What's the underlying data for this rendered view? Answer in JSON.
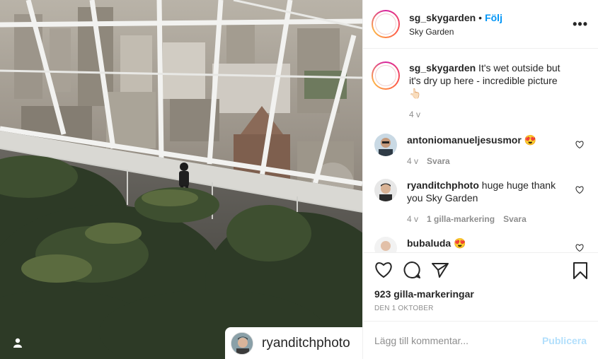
{
  "post": {
    "author": "sg_skygarden",
    "follow_label": "Följ",
    "location": "Sky Garden",
    "more_label": "•••"
  },
  "photo_tag": {
    "username": "ryanditchphoto"
  },
  "comments": [
    {
      "user": "sg_skygarden",
      "text": " It's wet outside but it's dry up here - incredible picture 👆🏻",
      "time": "4 v"
    },
    {
      "user": "antoniomanueljesusmor",
      "text": " 😍",
      "time": "4 v",
      "reply": "Svara"
    },
    {
      "user": "ryanditchphoto",
      "text": " huge huge thank you Sky Garden",
      "time": "4 v",
      "likes": "1 gilla-markering",
      "reply": "Svara"
    },
    {
      "user": "bubaluda",
      "text": " 😍"
    }
  ],
  "stats": {
    "likes": "923 gilla-markeringar",
    "date": "DEN 1 OKTOBER"
  },
  "add_comment": {
    "placeholder": "Lägg till kommentar...",
    "publish_label": "Publicera"
  },
  "icons": {
    "like": "heart-icon",
    "comment": "comment-icon",
    "share": "share-icon",
    "save": "bookmark-icon",
    "tagged": "user-tag-icon"
  }
}
